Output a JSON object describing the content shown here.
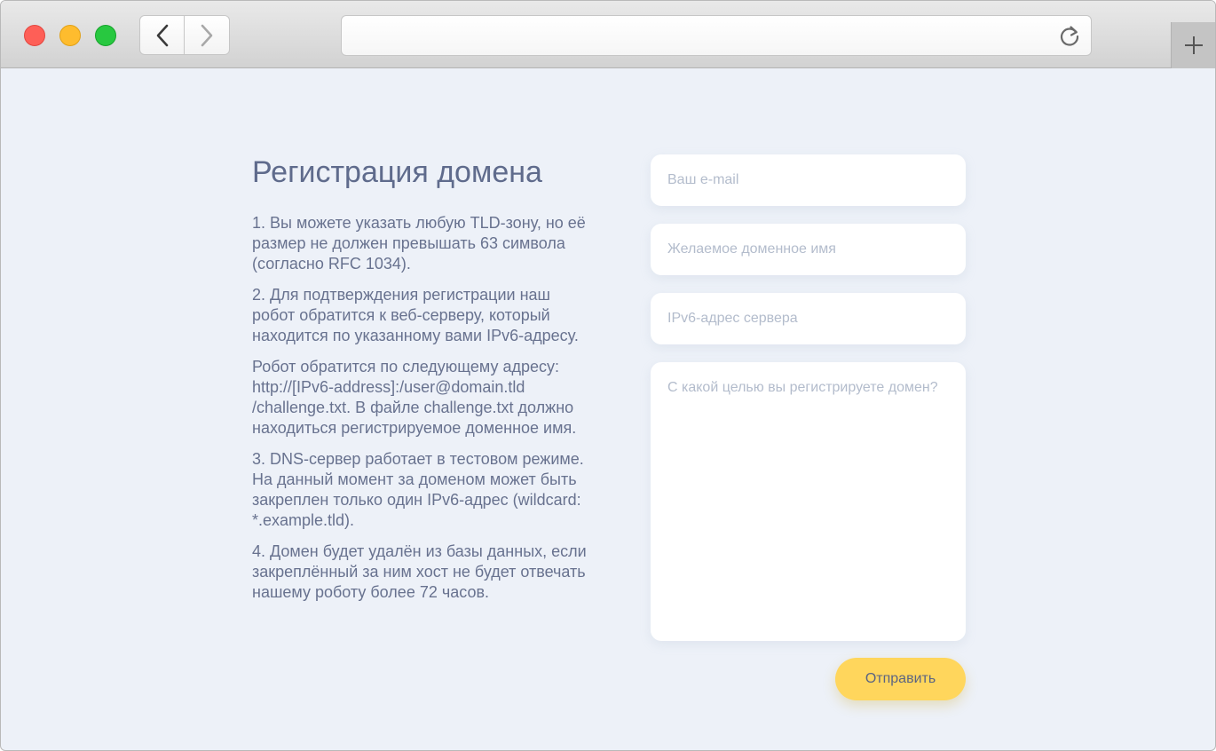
{
  "browser": {
    "url": "",
    "traffic_lights": {
      "close_color": "#fe5f57",
      "minimize_color": "#febc2e",
      "zoom_color": "#28c840"
    },
    "icons": {
      "back": "chevron-left-icon",
      "forward": "chevron-right-icon",
      "reload": "reload-icon",
      "new_tab": "plus-icon"
    }
  },
  "page": {
    "title": "Регистрация домена",
    "paragraphs": [
      "1. Вы можете указать любую TLD-зону, но её размер не должен превышать 63 символа (согласно RFC 1034).",
      "2. Для подтверждения регистрации наш робот обратится к веб-серверу, который находится по указанному вами IPv6-адресу.",
      "Робот обратится по следующему адресу: http://[IPv6-address]:/user@domain.tld /challenge.txt. В файле challenge.txt должно находиться регистрируемое доменное имя.",
      "3. DNS-сервер работает в тестовом режиме. На данный момент за доменом может быть закреплен только один IPv6-адрес (wildcard: *.example.tld).",
      "4. Домен будет удалён из базы данных, если закреплённый за ним хост не будет отвечать нашему роботу более 72 часов."
    ]
  },
  "form": {
    "email": {
      "placeholder": "Ваш e-mail",
      "value": ""
    },
    "domain": {
      "placeholder": "Желаемое доменное имя",
      "value": ""
    },
    "ipv6": {
      "placeholder": "IPv6-адрес сервера",
      "value": ""
    },
    "purpose": {
      "placeholder": "С какой целью вы регистрируете домен?",
      "value": ""
    },
    "submit_label": "Отправить"
  },
  "colors": {
    "background": "#edf1f8",
    "text": "#68728f",
    "accent": "#ffd65c"
  }
}
